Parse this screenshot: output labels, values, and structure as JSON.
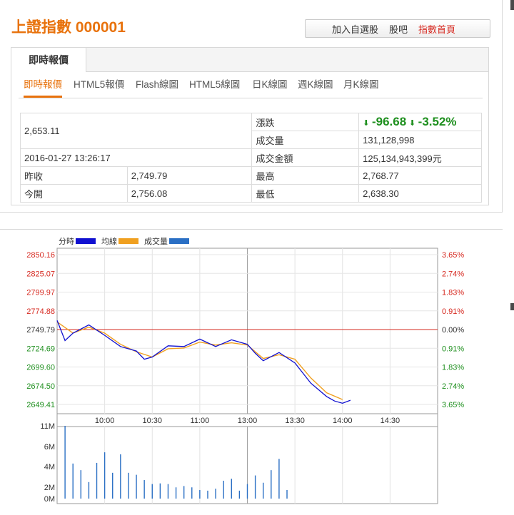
{
  "header": {
    "title": "上證指數 000001",
    "actions": [
      "加入自選股",
      "股吧",
      "指數首頁"
    ]
  },
  "tabs": {
    "main": "即時報價",
    "sub": [
      "即時報價",
      "HTML5報價",
      "Flash線圖",
      "HTML5線圖",
      "日K線圖",
      "週K線圖",
      "月K線圖"
    ]
  },
  "quote": {
    "price": "2,653.11",
    "datetime": "2016-01-27 13:26:17",
    "change_label": "漲跌",
    "change": "-96.68",
    "change_pct": "-3.52%",
    "volume_label": "成交量",
    "volume": "131,128,998",
    "amount_label": "成交金額",
    "amount": "125,134,943,399元",
    "prev_close_label": "昨收",
    "prev_close": "2,749.79",
    "high_label": "最高",
    "high": "2,768.77",
    "open_label": "今開",
    "open": "2,756.08",
    "low_label": "最低",
    "low": "2,638.30"
  },
  "colors": {
    "accent": "#e8720c",
    "up": "#d6281f",
    "down": "#1e8f1e",
    "price_line": "#1010d0",
    "avg_line": "#f0a020",
    "volume_bar": "#2a6fc4"
  },
  "chart_data": {
    "type": "line",
    "legend": [
      {
        "name": "分時",
        "color": "#1010d0"
      },
      {
        "name": "均線",
        "color": "#f0a020"
      },
      {
        "name": "成交量",
        "color": "#2a6fc4"
      }
    ],
    "prev_close": 2749.79,
    "y_ticks_left": [
      "2850.16",
      "2825.07",
      "2799.97",
      "2774.88",
      "2749.79",
      "2724.69",
      "2699.60",
      "2674.50",
      "2649.41"
    ],
    "y_ticks_right": [
      "3.65%",
      "2.74%",
      "1.83%",
      "0.91%",
      "0.00%",
      "0.91%",
      "1.83%",
      "2.74%",
      "3.65%"
    ],
    "ylim": [
      2649.41,
      2850.16
    ],
    "x_ticks": [
      "10:00",
      "10:30",
      "11:00",
      "13:00",
      "13:30",
      "14:00",
      "14:30"
    ],
    "price_series": {
      "name": "分時",
      "minutes": [
        0,
        5,
        10,
        20,
        30,
        40,
        50,
        55,
        60,
        70,
        80,
        90,
        100,
        110,
        120,
        125,
        130,
        140,
        150,
        160,
        170,
        175
      ],
      "values": [
        2762,
        2735,
        2745,
        2756,
        2742,
        2727,
        2721,
        2710,
        2713,
        2728,
        2727,
        2737,
        2727,
        2736,
        2730,
        2718,
        2708,
        2719,
        2705,
        2678,
        2660,
        2654
      ],
      "tail_minutes": [
        180,
        185
      ],
      "tail_values": [
        2651,
        2655
      ]
    },
    "avg_series": {
      "name": "均線",
      "minutes": [
        0,
        10,
        20,
        30,
        40,
        50,
        60,
        70,
        80,
        90,
        100,
        110,
        120,
        130,
        140,
        150,
        160,
        170,
        180
      ],
      "values": [
        2760,
        2745,
        2753,
        2745,
        2730,
        2720,
        2713,
        2724,
        2725,
        2733,
        2729,
        2732,
        2729,
        2711,
        2716,
        2710,
        2685,
        2665,
        2656
      ]
    },
    "volume_series": {
      "name": "成交量",
      "y_ticks": [
        "11M",
        "6M",
        "4M",
        "2M",
        "0M"
      ],
      "minutes": [
        5,
        10,
        15,
        20,
        25,
        30,
        35,
        40,
        45,
        50,
        55,
        60,
        65,
        70,
        75,
        80,
        85,
        90,
        95,
        100,
        105,
        110,
        115,
        120,
        125,
        130,
        135,
        140,
        145,
        150,
        155,
        160,
        165,
        170,
        175,
        180
      ],
      "values": [
        11,
        5.3,
        4.3,
        2.5,
        5.4,
        7,
        3.9,
        6.7,
        3.9,
        3.6,
        2.8,
        2.2,
        2.3,
        2.2,
        1.7,
        1.9,
        1.7,
        1.3,
        1.2,
        1.5,
        2.7,
        3,
        1.2,
        2.2,
        3.5,
        2.4,
        4.3,
        6,
        1.3
      ]
    }
  }
}
